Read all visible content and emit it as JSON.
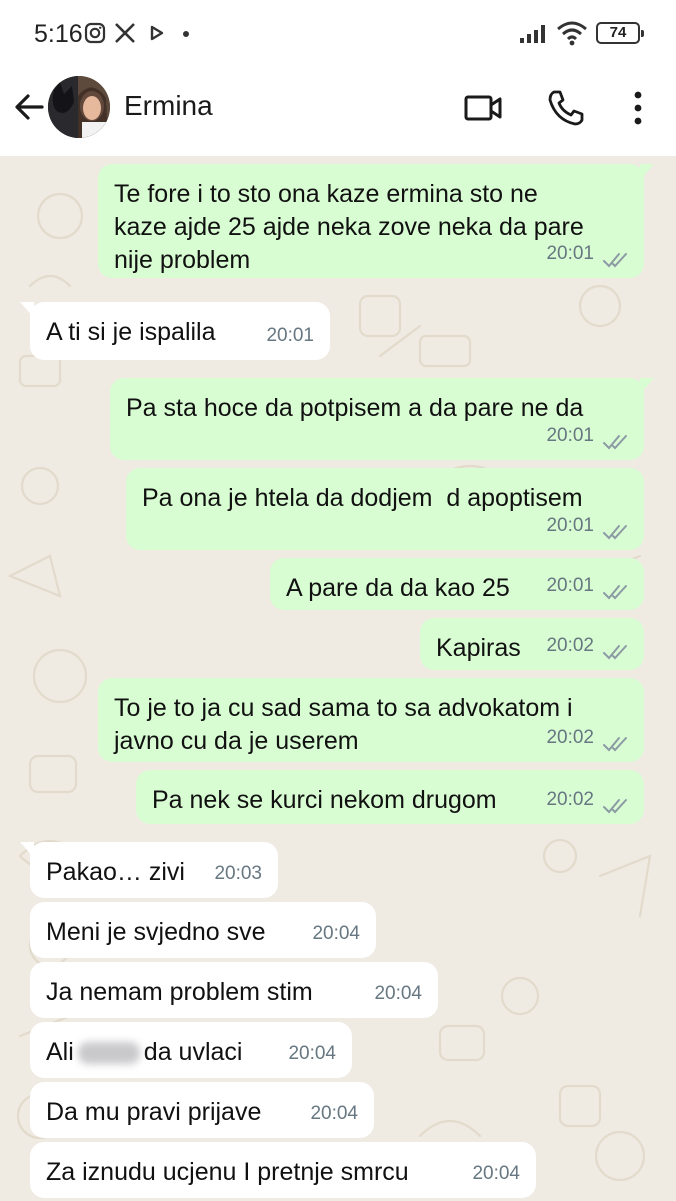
{
  "status_bar": {
    "time": "5:16",
    "battery": "74"
  },
  "header": {
    "contact_name": "Ermina"
  },
  "messages": [
    {
      "direction": "out",
      "text": "Te fore i to sto ona kaze ermina sto ne\nkaze ajde 25 ajde neka zove neka da pare\nnije problem",
      "time": "20:01"
    },
    {
      "direction": "in",
      "text": "A ti si je ispalila",
      "time": "20:01"
    },
    {
      "direction": "out",
      "text": "Pa sta hoce da potpisem a da pare ne da",
      "time": "20:01"
    },
    {
      "direction": "out",
      "text": "Pa ona je htela da dodjem  d apoptisem",
      "time": "20:01"
    },
    {
      "direction": "out",
      "text": "A pare da da kao 25",
      "time": "20:01"
    },
    {
      "direction": "out",
      "text": "Kapiras",
      "time": "20:02"
    },
    {
      "direction": "out",
      "text": "To je to ja cu sad sama to sa advokatom i\njavno cu da je userem",
      "time": "20:02"
    },
    {
      "direction": "out",
      "text": "Pa nek se kurci nekom drugom",
      "time": "20:02"
    },
    {
      "direction": "in",
      "text": "Pakao… zivi",
      "time": "20:03"
    },
    {
      "direction": "in",
      "text": "Meni je svjedno sve",
      "time": "20:04"
    },
    {
      "direction": "in",
      "text": "Ja nemam problem stim",
      "time": "20:04"
    },
    {
      "direction": "in",
      "text_before": "Ali",
      "text_after": "da uvlaci",
      "time": "20:04"
    },
    {
      "direction": "in",
      "text": "Da mu pravi prijave",
      "time": "20:04"
    },
    {
      "direction": "in",
      "text": "Za iznudu ucjenu I pretnje smrcu",
      "time": "20:04"
    }
  ],
  "colors": {
    "outgoing_bubble": "#d9fdd3",
    "incoming_bubble": "#ffffff",
    "chat_background": "#efeae2",
    "time_text": "#667781",
    "read_ticks": "#8b9aa3"
  },
  "icons": {
    "back": "arrow-left-icon",
    "video_call": "video-camera-icon",
    "voice_call": "phone-icon",
    "menu": "vertical-dots-icon",
    "ticks": "double-check-icon"
  }
}
